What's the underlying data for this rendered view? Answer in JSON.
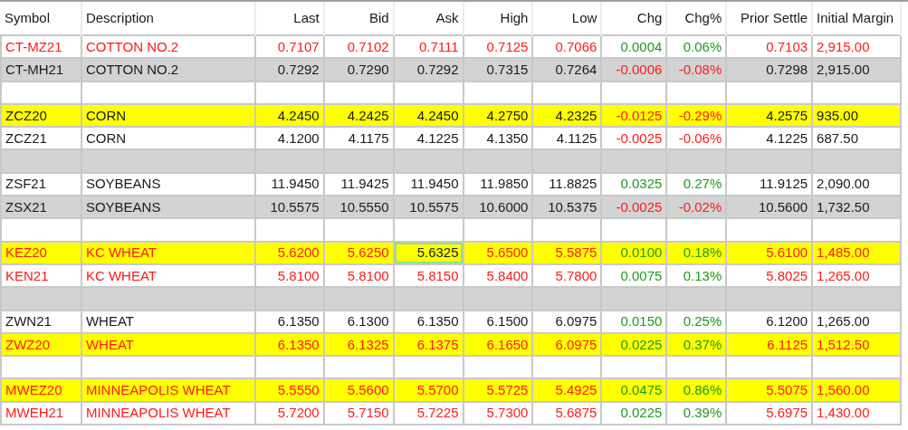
{
  "columns": [
    "Symbol",
    "Description",
    "Last",
    "Bid",
    "Ask",
    "High",
    "Low",
    "Chg",
    "Chg%",
    "Prior Settle",
    "Initial Margin"
  ],
  "rows": [
    {
      "kind": "quote",
      "highlighted": false,
      "shaded": false,
      "flagged": true,
      "rising": true,
      "focused_cell": false,
      "cells": [
        "CT-MZ21",
        "COTTON NO.2",
        "0.7107",
        "0.7102",
        "0.7111",
        "0.7125",
        "0.7066",
        "0.0004",
        "0.06%",
        "0.7103",
        "2,915.00"
      ]
    },
    {
      "kind": "quote",
      "highlighted": false,
      "shaded": true,
      "flagged": false,
      "rising": false,
      "focused_cell": false,
      "cells": [
        "CT-MH21",
        "COTTON NO.2",
        "0.7292",
        "0.7290",
        "0.7292",
        "0.7315",
        "0.7264",
        "-0.0006",
        "-0.08%",
        "0.7298",
        "2,915.00"
      ]
    },
    {
      "kind": "spacer",
      "shaded": false
    },
    {
      "kind": "quote",
      "highlighted": true,
      "flagged": false,
      "rising": false,
      "focused_cell": false,
      "cells": [
        "ZCZ20",
        "CORN",
        "4.2450",
        "4.2425",
        "4.2450",
        "4.2750",
        "4.2325",
        "-0.0125",
        "-0.29%",
        "4.2575",
        "935.00"
      ]
    },
    {
      "kind": "quote",
      "highlighted": false,
      "shaded": false,
      "flagged": false,
      "rising": false,
      "focused_cell": false,
      "cells": [
        "ZCZ21",
        "CORN",
        "4.1200",
        "4.1175",
        "4.1225",
        "4.1350",
        "4.1125",
        "-0.0025",
        "-0.06%",
        "4.1225",
        "687.50"
      ]
    },
    {
      "kind": "spacer",
      "shaded": true
    },
    {
      "kind": "quote",
      "highlighted": false,
      "shaded": false,
      "flagged": false,
      "rising": true,
      "focused_cell": false,
      "cells": [
        "ZSF21",
        "SOYBEANS",
        "11.9450",
        "11.9425",
        "11.9450",
        "11.9850",
        "11.8825",
        "0.0325",
        "0.27%",
        "11.9125",
        "2,090.00"
      ]
    },
    {
      "kind": "quote",
      "highlighted": false,
      "shaded": true,
      "flagged": false,
      "rising": false,
      "focused_cell": false,
      "cells": [
        "ZSX21",
        "SOYBEANS",
        "10.5575",
        "10.5550",
        "10.5575",
        "10.6000",
        "10.5375",
        "-0.0025",
        "-0.02%",
        "10.5600",
        "1,732.50"
      ]
    },
    {
      "kind": "spacer",
      "shaded": false
    },
    {
      "kind": "quote",
      "highlighted": true,
      "flagged": true,
      "rising": true,
      "focused_cell": true,
      "cells": [
        "KEZ20",
        "KC WHEAT",
        "5.6200",
        "5.6250",
        "5.6325",
        "5.6500",
        "5.5875",
        "0.0100",
        "0.18%",
        "5.6100",
        "1,485.00"
      ]
    },
    {
      "kind": "quote",
      "highlighted": false,
      "shaded": false,
      "flagged": true,
      "rising": true,
      "focused_cell": false,
      "cells": [
        "KEN21",
        "KC WHEAT",
        "5.8100",
        "5.8100",
        "5.8150",
        "5.8400",
        "5.7800",
        "0.0075",
        "0.13%",
        "5.8025",
        "1,265.00"
      ]
    },
    {
      "kind": "spacer",
      "shaded": true
    },
    {
      "kind": "quote",
      "highlighted": false,
      "shaded": false,
      "flagged": false,
      "rising": true,
      "focused_cell": false,
      "cells": [
        "ZWN21",
        "WHEAT",
        "6.1350",
        "6.1300",
        "6.1350",
        "6.1500",
        "6.0975",
        "0.0150",
        "0.25%",
        "6.1200",
        "1,265.00"
      ]
    },
    {
      "kind": "quote",
      "highlighted": true,
      "flagged": true,
      "rising": true,
      "focused_cell": false,
      "cells": [
        "ZWZ20",
        "WHEAT",
        "6.1350",
        "6.1325",
        "6.1375",
        "6.1650",
        "6.0975",
        "0.0225",
        "0.37%",
        "6.1125",
        "1,512.50"
      ]
    },
    {
      "kind": "spacer",
      "shaded": false
    },
    {
      "kind": "quote",
      "highlighted": true,
      "flagged": true,
      "rising": true,
      "focused_cell": false,
      "cells": [
        "MWEZ20",
        "MINNEAPOLIS WHEAT",
        "5.5550",
        "5.5600",
        "5.5700",
        "5.5725",
        "5.4925",
        "0.0475",
        "0.86%",
        "5.5075",
        "1,560.00"
      ]
    },
    {
      "kind": "quote",
      "highlighted": false,
      "shaded": false,
      "flagged": true,
      "rising": true,
      "focused_cell": false,
      "cells": [
        "MWEH21",
        "MINNEAPOLIS WHEAT",
        "5.7200",
        "5.7150",
        "5.7225",
        "5.7300",
        "5.6875",
        "0.0225",
        "0.39%",
        "5.6975",
        "1,430.00"
      ]
    }
  ]
}
